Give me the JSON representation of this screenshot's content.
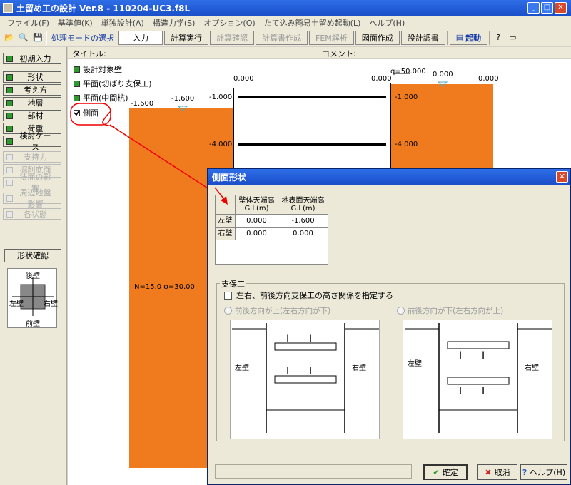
{
  "window": {
    "title": "土留め工の設計 Ver.8 - 110204-UC3.f8L"
  },
  "menu": [
    "ファイル(F)",
    "基準値(K)",
    "単独設計(A)",
    "構造力学(S)",
    "オプション(O)",
    "たて込み簡易土留め起動(L)",
    "ヘルプ(H)"
  ],
  "toolbar": {
    "mode_label": "処理モードの選択",
    "input": "入力",
    "calc_run": "計算実行",
    "calc_check": "計算確認",
    "report_create": "計算書作成",
    "fem": "FEM解析",
    "drawing": "図面作成",
    "design_report": "設計調書",
    "launch": "起動"
  },
  "left_panel": {
    "items": [
      {
        "label": "初期入力",
        "enabled": true
      },
      {
        "label": "形状",
        "enabled": true
      },
      {
        "label": "考え方",
        "enabled": true
      },
      {
        "label": "地層",
        "enabled": true
      },
      {
        "label": "部材",
        "enabled": true
      },
      {
        "label": "荷重",
        "enabled": true
      },
      {
        "label": "検討ケース",
        "enabled": true
      },
      {
        "label": "支持力",
        "enabled": false
      },
      {
        "label": "掘削底面",
        "enabled": false
      },
      {
        "label": "法面の影響",
        "enabled": false
      },
      {
        "label": "周辺地盤影響",
        "enabled": false
      },
      {
        "label": "各状態",
        "enabled": false
      }
    ],
    "shape_check": "形状確認",
    "compass": {
      "back": "後壁",
      "front": "前壁",
      "left": "左壁",
      "right": "右壁"
    }
  },
  "header": {
    "title_label": "タイトル:",
    "comment_label": "コメント:"
  },
  "canvas": {
    "checks": [
      "設計対象壁",
      "平面(切ばり支保工)",
      "平面(中間杭)",
      "側面"
    ],
    "labels": {
      "top_left": "0.000",
      "top_right": "0.000",
      "top_right2": "0.000",
      "top_right3": "0.000",
      "load": "q=50.000",
      "gl_left_a": "-1.600",
      "gl_left_b": "-1.600",
      "strut1_l": "-1.000",
      "strut1_r": "-1.000",
      "strut2_l": "-4.000",
      "strut2_r": "-4.000",
      "soil": "N=15.0 φ=30.00"
    },
    "soil_color": "#f07b1e"
  },
  "dialog": {
    "title": "側面形状",
    "table": {
      "headers": [
        "壁体天端高\nG.L(m)",
        "地表面天端高\nG.L(m)"
      ],
      "rows": [
        {
          "label": "左壁",
          "wall": "0.000",
          "ground": "-1.600"
        },
        {
          "label": "右壁",
          "wall": "0.000",
          "ground": "0.000"
        }
      ]
    },
    "shoho_title": "支保工",
    "checkbox_label": "左右、前後方向支保工の高さ関係を指定する",
    "radio1": "前後方向が上(左右方向が下)",
    "radio2": "前後方向が下(左右方向が上)",
    "diagram_left": "左壁",
    "diagram_right": "右壁",
    "ok": "確定",
    "cancel": "取消",
    "help": "ヘルプ(H)"
  }
}
